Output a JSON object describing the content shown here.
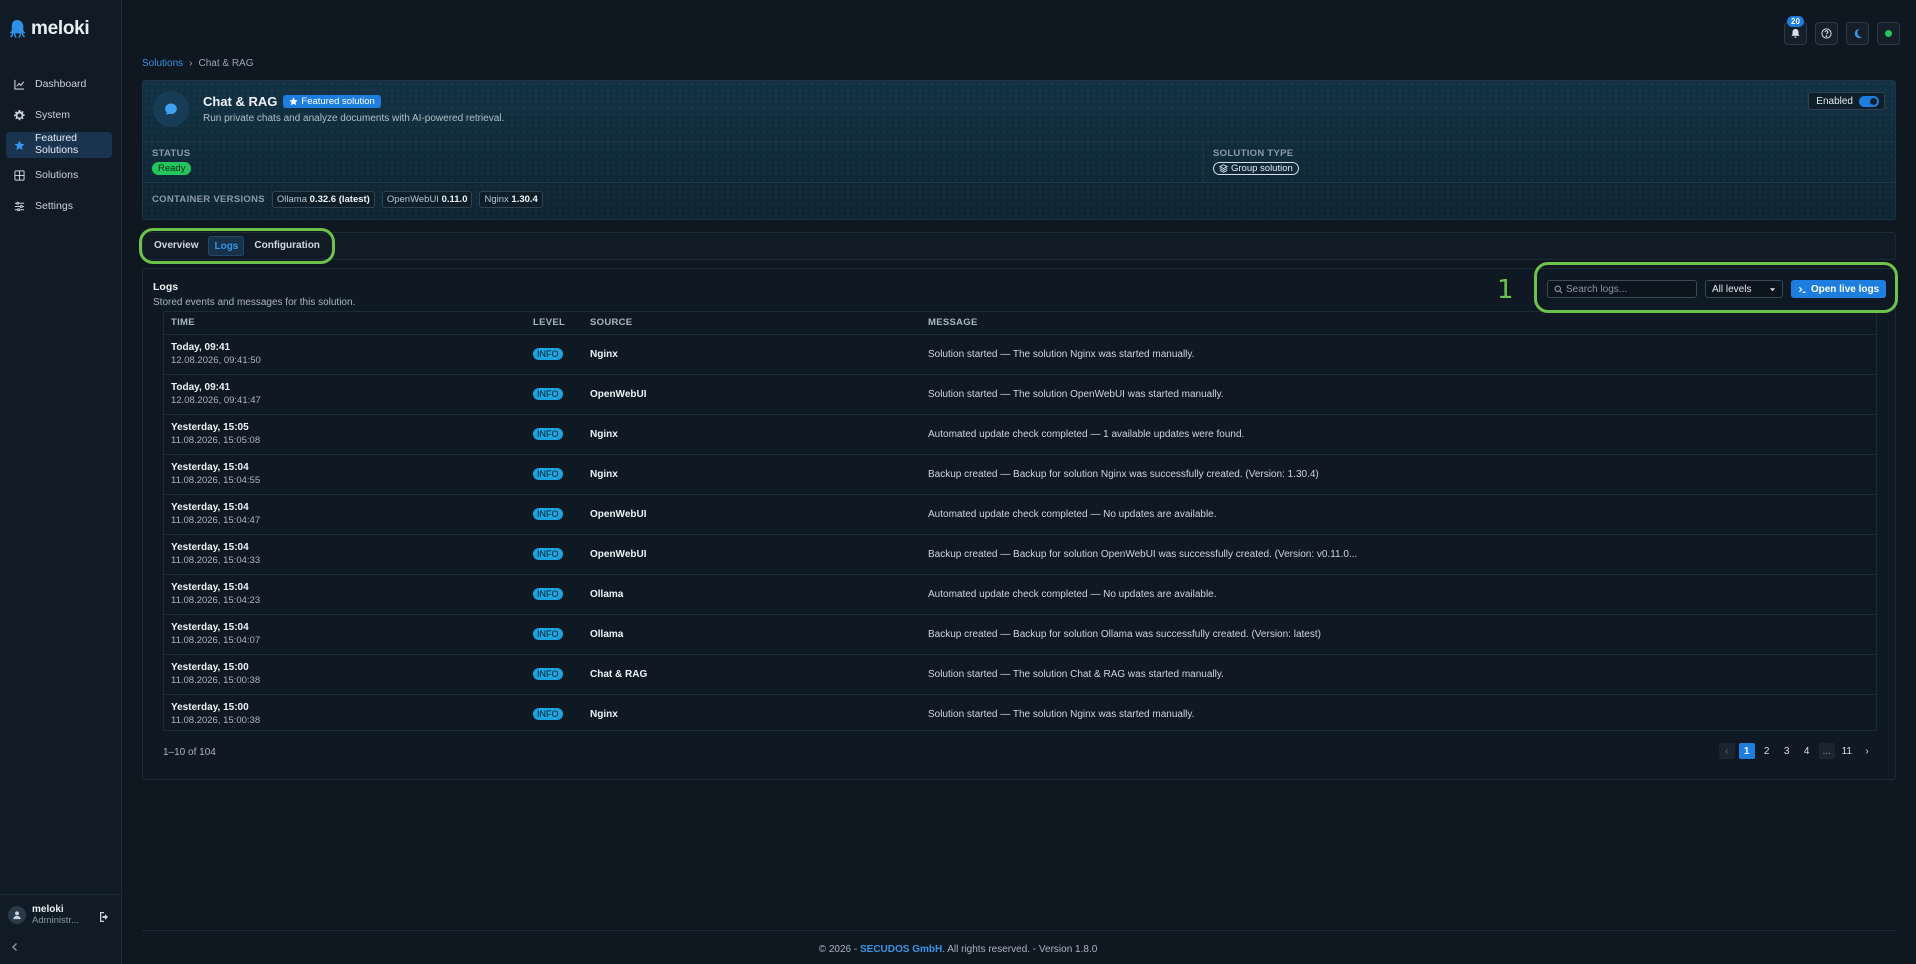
{
  "app": {
    "logo_text": "meloki"
  },
  "sidebar": {
    "items": [
      {
        "label": "Dashboard",
        "icon": "chart-line-icon"
      },
      {
        "label": "System",
        "icon": "gear-icon"
      },
      {
        "label": "Featured Solutions",
        "icon": "star-icon",
        "active": true
      },
      {
        "label": "Solutions",
        "icon": "grid-icon"
      },
      {
        "label": "Settings",
        "icon": "sliders-icon"
      }
    ],
    "user": {
      "name": "meloki",
      "role": "Administr..."
    }
  },
  "topbar": {
    "notifications_count": "20"
  },
  "breadcrumb": {
    "parent": "Solutions",
    "separator": "›",
    "current": "Chat & RAG"
  },
  "solution": {
    "title": "Chat & RAG",
    "featured_label": "Featured solution",
    "description": "Run private chats and analyze documents with AI-powered retrieval.",
    "enabled_label": "Enabled",
    "status_label": "STATUS",
    "status_value": "Ready",
    "type_label": "SOLUTION TYPE",
    "type_value": "Group solution",
    "versions_label": "CONTAINER VERSIONS",
    "versions": [
      {
        "name": "Ollama",
        "version": "0.32.6 (latest)"
      },
      {
        "name": "OpenWebUI",
        "version": "0.11.0"
      },
      {
        "name": "Nginx",
        "version": "1.30.4"
      }
    ]
  },
  "tabs": [
    {
      "label": "Overview"
    },
    {
      "label": "Logs",
      "active": true
    },
    {
      "label": "Configuration"
    }
  ],
  "annotation": {
    "number": "1"
  },
  "logs": {
    "title": "Logs",
    "subtitle": "Stored events and messages for this solution.",
    "search_placeholder": "Search logs...",
    "level_filter": "All levels",
    "live_button": "Open live logs",
    "columns": [
      "TIME",
      "LEVEL",
      "SOURCE",
      "MESSAGE"
    ],
    "rows": [
      {
        "time": "Today, 09:41",
        "timestamp": "12.08.2026, 09:41:50",
        "level": "INFO",
        "source": "Nginx",
        "message": "Solution started — The solution Nginx was started manually."
      },
      {
        "time": "Today, 09:41",
        "timestamp": "12.08.2026, 09:41:47",
        "level": "INFO",
        "source": "OpenWebUI",
        "message": "Solution started — The solution OpenWebUI was started manually."
      },
      {
        "time": "Yesterday, 15:05",
        "timestamp": "11.08.2026, 15:05:08",
        "level": "INFO",
        "source": "Nginx",
        "message": "Automated update check completed — 1 available updates were found."
      },
      {
        "time": "Yesterday, 15:04",
        "timestamp": "11.08.2026, 15:04:55",
        "level": "INFO",
        "source": "Nginx",
        "message": "Backup created — Backup for solution Nginx was successfully created. (Version: 1.30.4)"
      },
      {
        "time": "Yesterday, 15:04",
        "timestamp": "11.08.2026, 15:04:47",
        "level": "INFO",
        "source": "OpenWebUI",
        "message": "Automated update check completed — No updates are available."
      },
      {
        "time": "Yesterday, 15:04",
        "timestamp": "11.08.2026, 15:04:33",
        "level": "INFO",
        "source": "OpenWebUI",
        "message": "Backup created — Backup for solution OpenWebUI was successfully created. (Version: v0.11.0..."
      },
      {
        "time": "Yesterday, 15:04",
        "timestamp": "11.08.2026, 15:04:23",
        "level": "INFO",
        "source": "Ollama",
        "message": "Automated update check completed — No updates are available."
      },
      {
        "time": "Yesterday, 15:04",
        "timestamp": "11.08.2026, 15:04:07",
        "level": "INFO",
        "source": "Ollama",
        "message": "Backup created — Backup for solution Ollama was successfully created. (Version: latest)"
      },
      {
        "time": "Yesterday, 15:00",
        "timestamp": "11.08.2026, 15:00:38",
        "level": "INFO",
        "source": "Chat & RAG",
        "message": "Solution started — The solution Chat & RAG was started manually."
      },
      {
        "time": "Yesterday, 15:00",
        "timestamp": "11.08.2026, 15:00:38",
        "level": "INFO",
        "source": "Nginx",
        "message": "Solution started — The solution Nginx was started manually."
      }
    ],
    "count_text": "1–10 of 104",
    "pagination": {
      "prev": "‹",
      "pages": [
        "1",
        "2",
        "3",
        "4"
      ],
      "ellipsis": "...",
      "last": "11",
      "next": "›"
    }
  },
  "footer": {
    "prefix": "© 2026 - ",
    "company": "SECUDOS GmbH",
    "suffix": ". All rights reserved. - Version 1.8.0"
  },
  "colors": {
    "accent": "#1e7ee0",
    "success": "#22c55e",
    "highlight": "#6cc24a",
    "info": "#1ca4df"
  }
}
